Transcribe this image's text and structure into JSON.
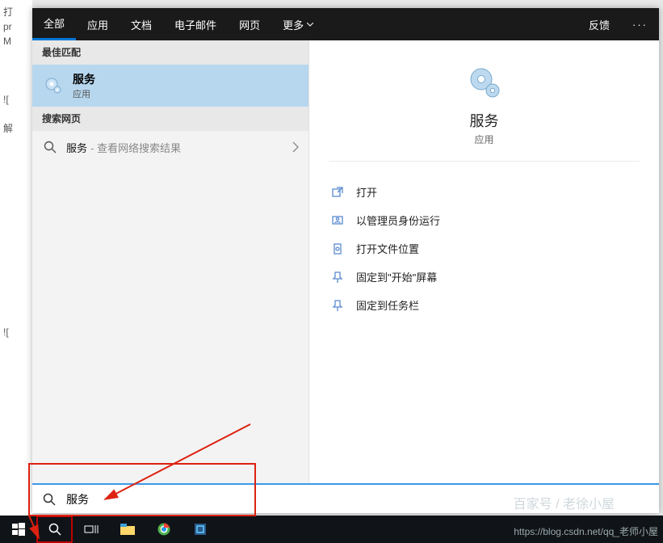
{
  "tabs": {
    "all": "全部",
    "apps": "应用",
    "docs": "文档",
    "email": "电子邮件",
    "web": "网页",
    "more": "更多"
  },
  "header": {
    "feedback": "反馈",
    "more_dots": "···"
  },
  "left": {
    "best_match_header": "最佳匹配",
    "best_match": {
      "title": "服务",
      "subtitle": "应用"
    },
    "web_header": "搜索网页",
    "web_item": {
      "term": "服务",
      "sub": "- 查看网络搜索结果"
    }
  },
  "detail": {
    "title": "服务",
    "subtitle": "应用"
  },
  "actions": {
    "open": "打开",
    "run_admin": "以管理员身份运行",
    "open_location": "打开文件位置",
    "pin_start": "固定到\"开始\"屏幕",
    "pin_taskbar": "固定到任务栏"
  },
  "search_box": {
    "value": "服务"
  },
  "watermark": "https://blog.csdn.net/qq_老师小屋",
  "watermark2": "百家号 / 老徐小屋",
  "bg": {
    "l1": "打",
    "l2": "pr",
    "l3": "M",
    "l4": "![",
    "l5": "解",
    "l6": "!["
  }
}
